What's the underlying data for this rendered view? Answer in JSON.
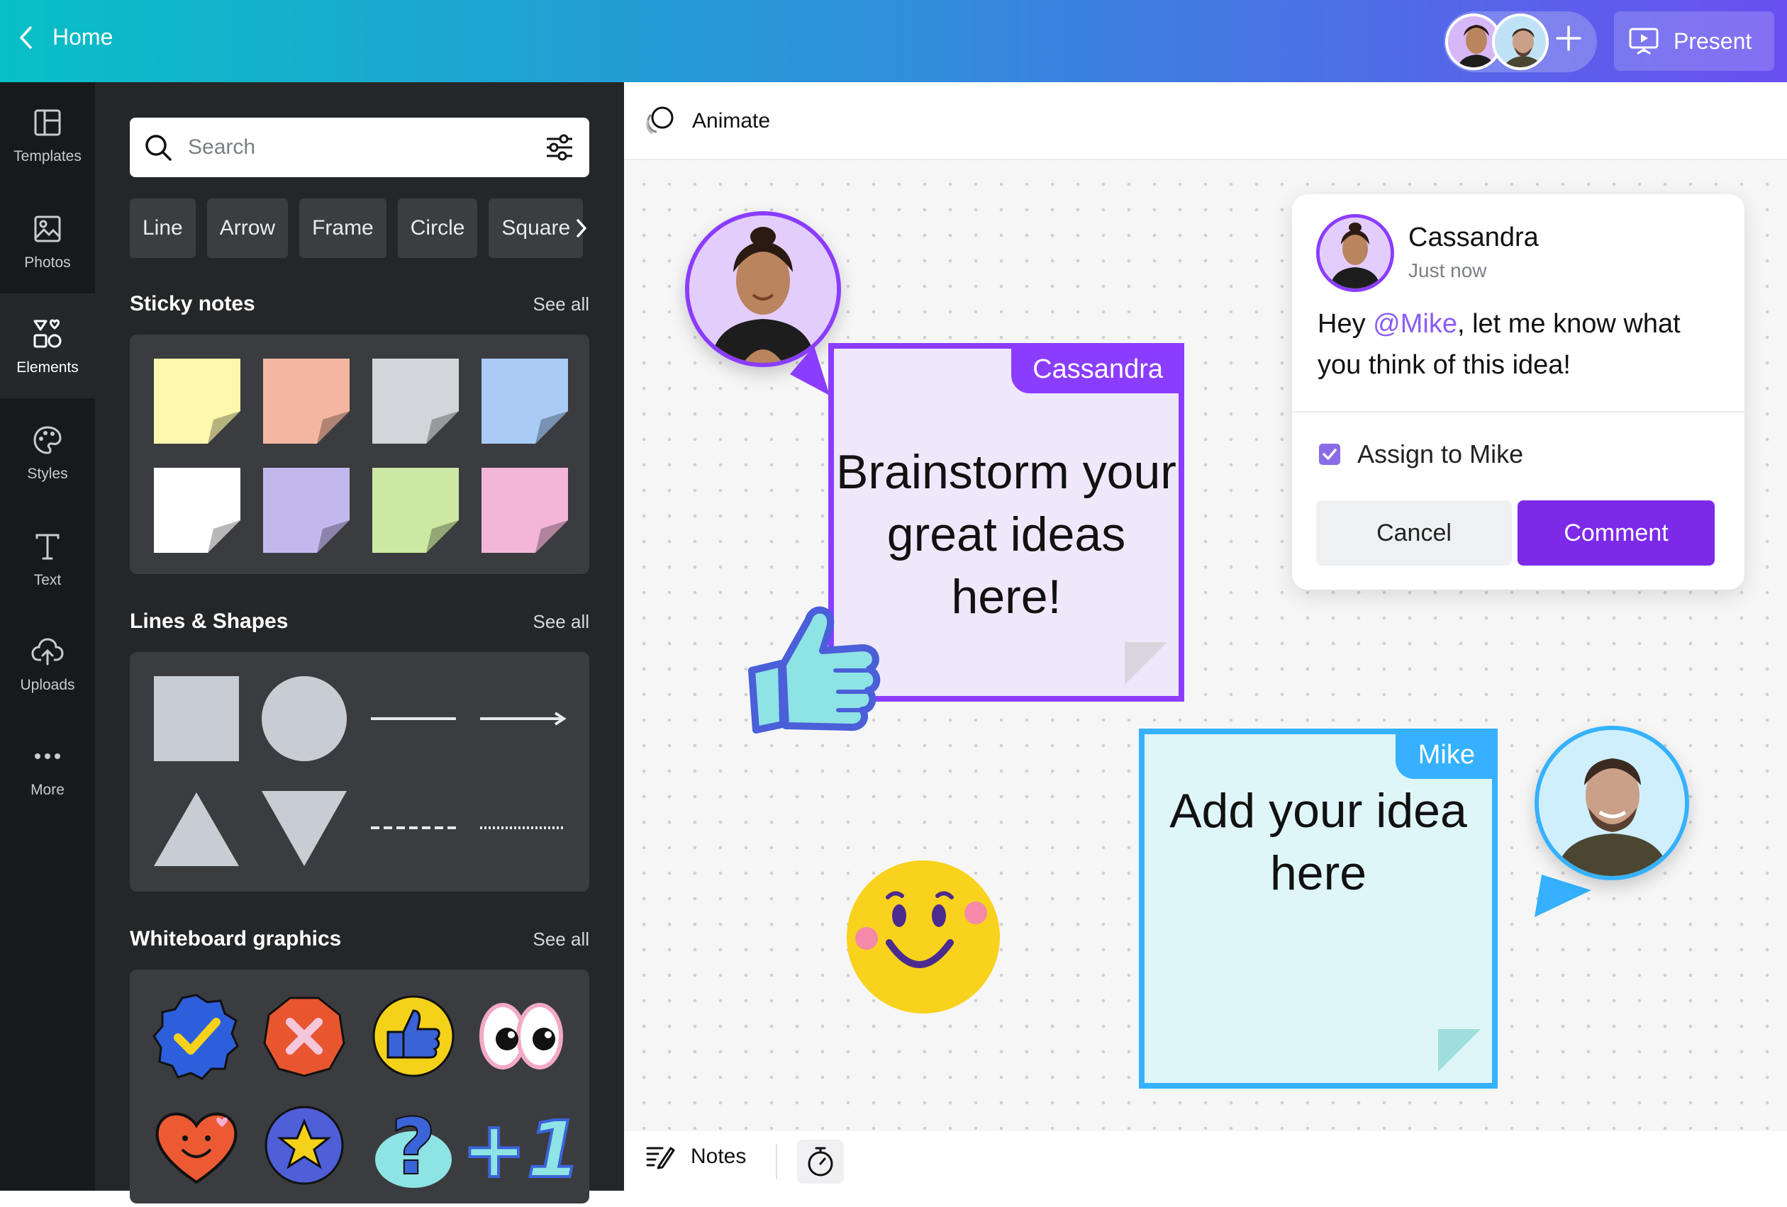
{
  "header": {
    "home_label": "Home",
    "present_label": "Present",
    "add_icon": "plus-icon"
  },
  "sidebar": {
    "items": [
      {
        "label": "Templates",
        "icon": "templates-icon"
      },
      {
        "label": "Photos",
        "icon": "photos-icon"
      },
      {
        "label": "Elements",
        "icon": "elements-icon",
        "active": true
      },
      {
        "label": "Styles",
        "icon": "styles-icon"
      },
      {
        "label": "Text",
        "icon": "text-icon"
      },
      {
        "label": "Uploads",
        "icon": "uploads-icon"
      },
      {
        "label": "More",
        "icon": "more-icon"
      }
    ]
  },
  "panel": {
    "search_placeholder": "Search",
    "chips": [
      "Line",
      "Arrow",
      "Frame",
      "Circle",
      "Square"
    ],
    "sections": {
      "sticky": {
        "title": "Sticky notes",
        "see_all": "See all",
        "colors": [
          "#fbf7ad",
          "#f5b6a1",
          "#d3d5da",
          "#a9cbf5",
          "#ffffff",
          "#c3b8ee",
          "#cce8a2",
          "#f3b6d9"
        ]
      },
      "shapes": {
        "title": "Lines & Shapes",
        "see_all": "See all"
      },
      "graphics": {
        "title": "Whiteboard graphics",
        "see_all": "See all"
      }
    }
  },
  "toolbar": {
    "animate_label": "Animate",
    "notes_label": "Notes"
  },
  "canvas": {
    "note_cassandra": {
      "tag": "Cassandra",
      "text": "Brainstorm your great ideas here!",
      "color": "#8b3dff"
    },
    "note_mike": {
      "tag": "Mike",
      "text": "Add your idea here",
      "color": "#35b1ff"
    }
  },
  "comment": {
    "author": "Cassandra",
    "time": "Just now",
    "msg_before": "Hey ",
    "mention": "@Mike",
    "msg_after": ", let me know what you think of this idea!",
    "assign_label": "Assign to Mike",
    "assign_checked": true,
    "cancel_label": "Cancel",
    "comment_label": "Comment"
  },
  "colors": {
    "accent": "#7d2ae8",
    "mike": "#35b1ff",
    "cassandra": "#8b3dff"
  }
}
